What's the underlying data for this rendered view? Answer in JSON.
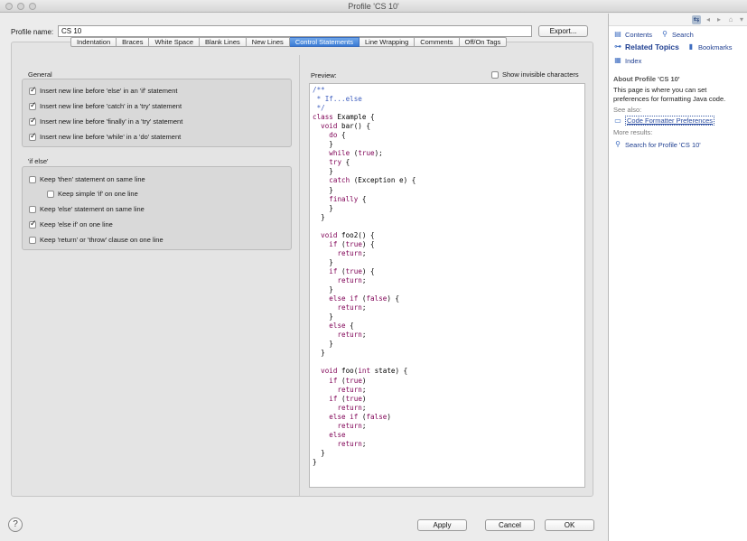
{
  "window": {
    "title": "Profile 'CS 10'"
  },
  "profile": {
    "label": "Profile name:",
    "value": "CS 10",
    "export_label": "Export..."
  },
  "tabs": [
    {
      "label": "Indentation"
    },
    {
      "label": "Braces"
    },
    {
      "label": "White Space"
    },
    {
      "label": "Blank Lines"
    },
    {
      "label": "New Lines"
    },
    {
      "label": "Control Statements",
      "active": true
    },
    {
      "label": "Line Wrapping"
    },
    {
      "label": "Comments"
    },
    {
      "label": "Off/On Tags"
    }
  ],
  "general": {
    "title": "General",
    "options": [
      {
        "label": "Insert new line before 'else' in an 'if' statement",
        "checked": true
      },
      {
        "label": "Insert new line before 'catch' in a 'try' statement",
        "checked": true
      },
      {
        "label": "Insert new line before 'finally' in a 'try' statement",
        "checked": true
      },
      {
        "label": "Insert new line before 'while' in a 'do' statement",
        "checked": true
      }
    ]
  },
  "ifelse": {
    "title": "'if else'",
    "options": [
      {
        "label": "Keep 'then' statement on same line",
        "checked": false
      },
      {
        "label": "Keep simple 'if' on one line",
        "checked": false
      },
      {
        "label": "Keep 'else' statement on same line",
        "checked": false
      },
      {
        "label": "Keep 'else if' on one line",
        "checked": true
      },
      {
        "label": "Keep 'return' or 'throw' clause on one line",
        "checked": false
      }
    ]
  },
  "preview": {
    "label": "Preview:",
    "show_invisible_label": "Show invisible characters",
    "show_invisible_checked": false,
    "code_lines": [
      "/**",
      " * If...else",
      " */",
      "class Example {",
      "  void bar() {",
      "    do {",
      "    }",
      "    while (true);",
      "    try {",
      "    }",
      "    catch (Exception e) {",
      "    }",
      "    finally {",
      "    }",
      "  }",
      "",
      "  void foo2() {",
      "    if (true) {",
      "      return;",
      "    }",
      "    if (true) {",
      "      return;",
      "    }",
      "    else if (false) {",
      "      return;",
      "    }",
      "    else {",
      "      return;",
      "    }",
      "  }",
      "",
      "  void foo(int state) {",
      "    if (true)",
      "      return;",
      "    if (true)",
      "      return;",
      "    else if (false)",
      "      return;",
      "    else",
      "      return;",
      "  }",
      "}"
    ]
  },
  "buttons": {
    "apply": "Apply",
    "cancel": "Cancel",
    "ok": "OK",
    "help": "?"
  },
  "help_pane": {
    "contents": "Contents",
    "search": "Search",
    "related_topics": "Related Topics",
    "bookmarks": "Bookmarks",
    "index": "Index",
    "about_title": "About Profile 'CS 10'",
    "about_text": "This page is where you can set preferences for formatting Java code.",
    "see_also": "See also:",
    "see_also_link": "Code Formatter Preferences",
    "more_results": "More results:",
    "more_results_link": "Search for Profile 'CS 10'"
  }
}
